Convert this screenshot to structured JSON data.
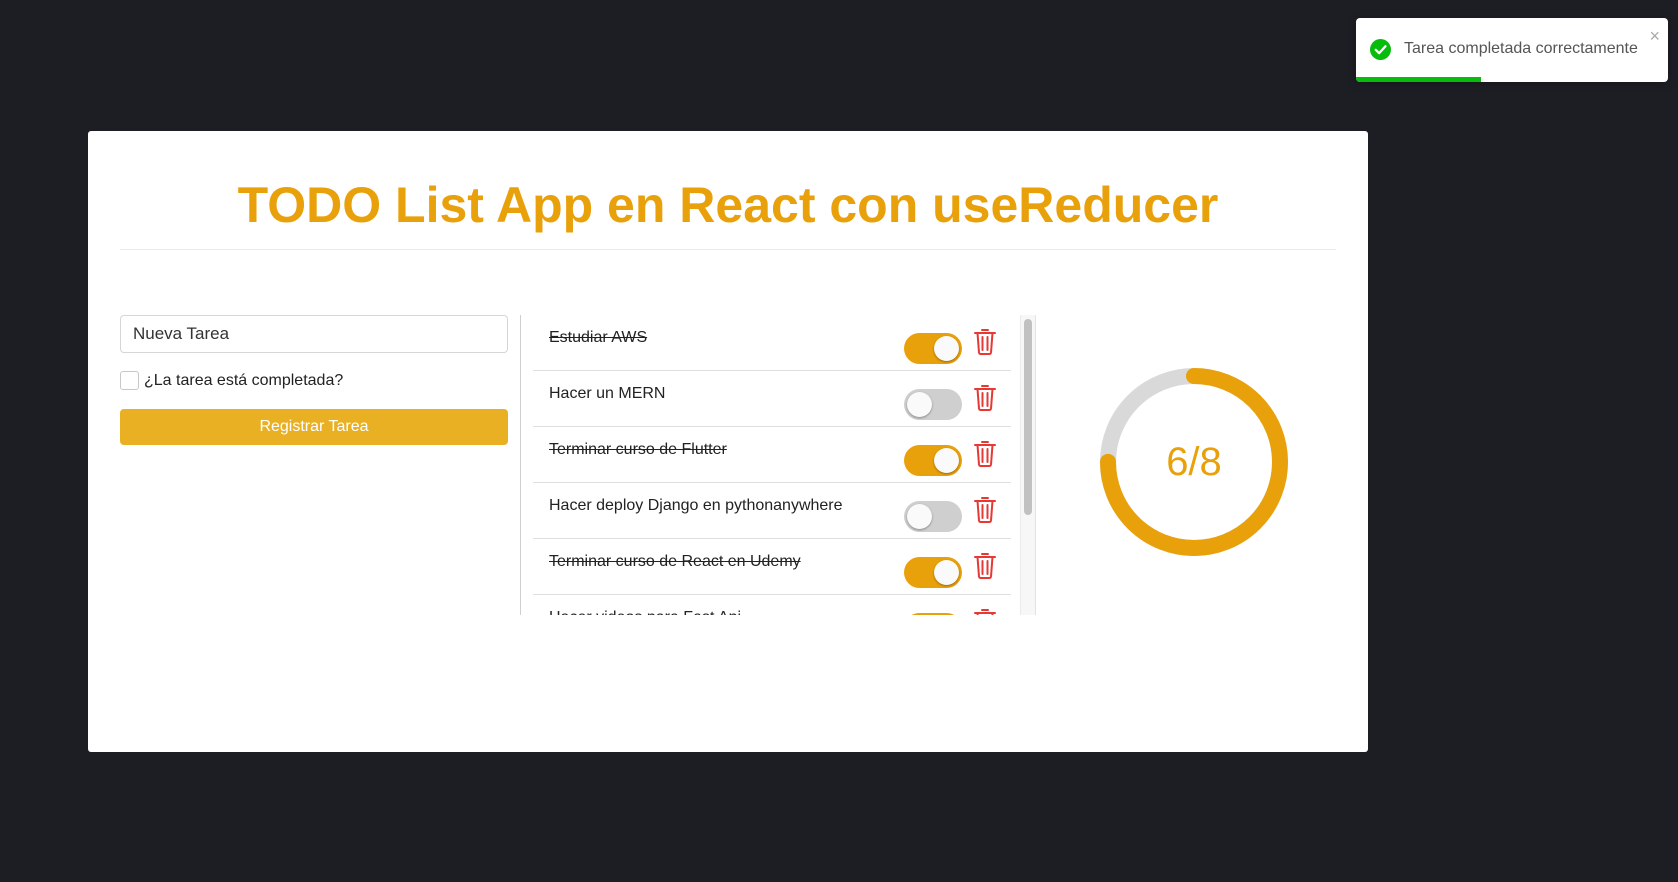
{
  "title": "TODO List App en React con useReducer",
  "form": {
    "placeholder": "Nueva Tarea",
    "checkbox_label": "¿La tarea está completada?",
    "submit_label": "Registrar Tarea"
  },
  "tasks": [
    {
      "text": "Estudiar AWS",
      "completed": true
    },
    {
      "text": "Hacer un MERN",
      "completed": false
    },
    {
      "text": "Terminar curso de Flutter",
      "completed": true
    },
    {
      "text": "Hacer deploy Django en pythonanywhere",
      "completed": false
    },
    {
      "text": "Terminar curso de React en Udemy",
      "completed": true
    },
    {
      "text": "Hacer videos para Fast Api",
      "completed": true
    }
  ],
  "progress": {
    "completed": 6,
    "total": 8,
    "label": "6/8"
  },
  "toast": {
    "message": "Tarea completada correctamente",
    "close_symbol": "×",
    "timer_fraction": 0.4
  },
  "colors": {
    "accent": "#e9a10b",
    "button": "#e9b023",
    "track": "#d9d9d9",
    "trash": "#e53935",
    "success": "#07bc0c"
  },
  "icons": {
    "delete": "trash-icon",
    "toast": "check-circle-icon",
    "close": "close-icon"
  }
}
